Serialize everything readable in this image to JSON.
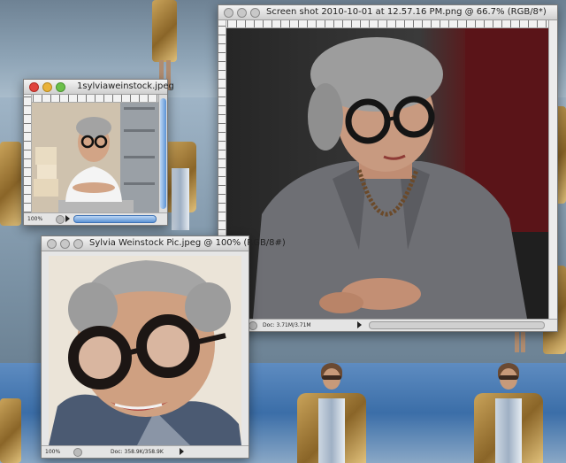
{
  "windows": {
    "screenshot": {
      "title": "Screen shot 2010-10-01 at 12.57.16 PM.png @ 66.7% (RGB/8*)",
      "zoom": "",
      "doc_info": "Doc: 3.71M/3.71M"
    },
    "sylvia_small": {
      "title": "1sylviaweinstock.jpeg",
      "zoom": "100%",
      "doc_info": ""
    },
    "sylvia_pic": {
      "title": "Sylvia Weinstock Pic.jpeg @ 100% (RGB/8#)",
      "zoom": "100%",
      "doc_info": "Doc: 358.9K/358.9K"
    }
  },
  "colors": {
    "accent_blue": "#5c93d6",
    "close_red": "#e0443e",
    "minimize_yellow": "#e9b23a",
    "zoom_green": "#6cc04a",
    "wallpaper": "#7f97aa"
  },
  "icons": [
    "close-icon",
    "minimize-icon",
    "zoom-icon",
    "status-menu-arrow-icon"
  ]
}
